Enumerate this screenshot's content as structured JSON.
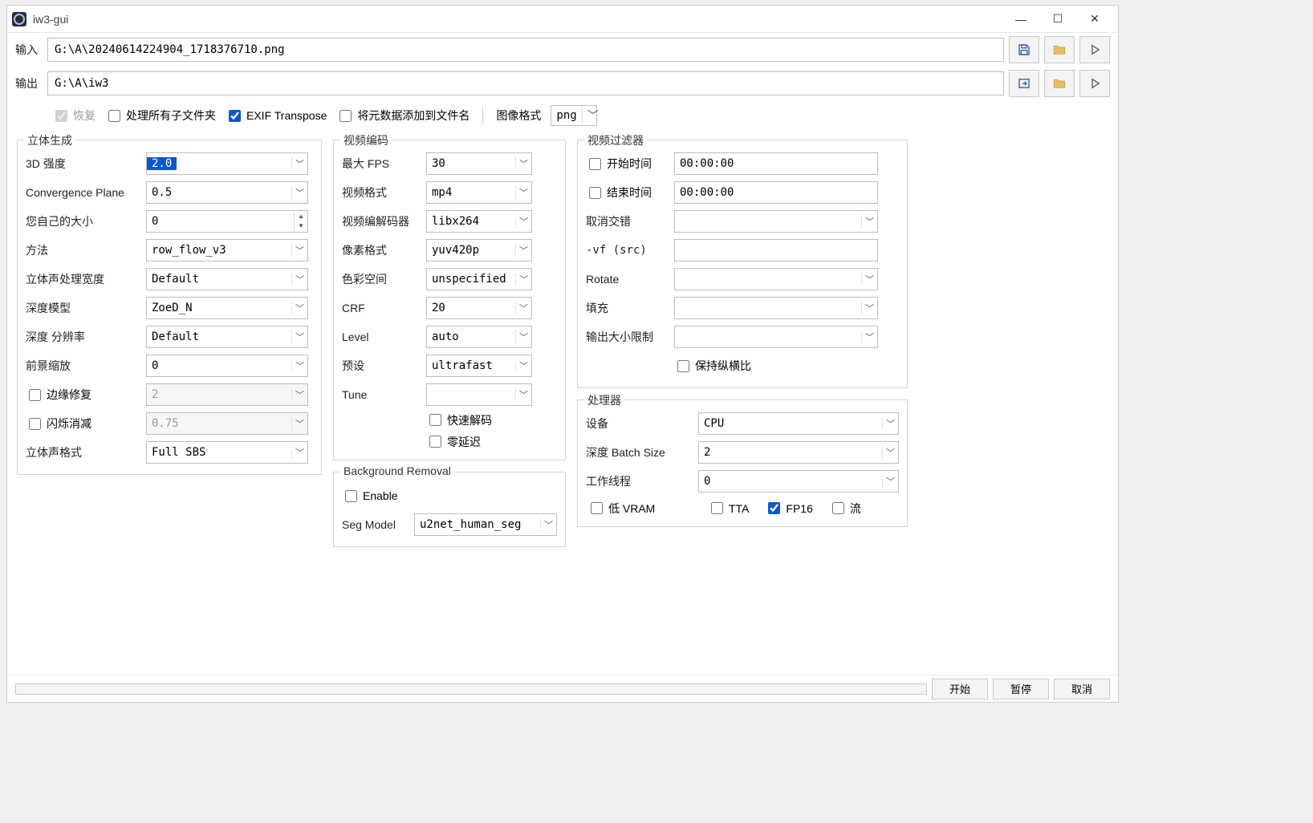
{
  "window_title": "iw3-gui",
  "io": {
    "input_label": "输入",
    "input_value": "G:\\A\\20240614224904_1718376710.png",
    "output_label": "输出",
    "output_value": "G:\\A\\iw3"
  },
  "options_row": {
    "restore": "恢复",
    "process_subfolders": "处理所有子文件夹",
    "exif_transpose": "EXIF Transpose",
    "append_metadata_to_filename": "将元数据添加到文件名",
    "image_format_label": "图像格式",
    "image_format_value": "png"
  },
  "stereo_gen": {
    "panel_title": "立体生成",
    "strength_label": "3D 强度",
    "strength_value": "2.0",
    "convergence_label": "Convergence Plane",
    "convergence_value": "0.5",
    "own_size_label": "您自己的大小",
    "own_size_value": "0",
    "method_label": "方法",
    "method_value": "row_flow_v3",
    "stereo_width_label": "立体声处理宽度",
    "stereo_width_value": "Default",
    "depth_model_label": "深度模型",
    "depth_model_value": "ZoeD_N",
    "depth_res_label": "深度 分辨率",
    "depth_res_value": "Default",
    "fg_zoom_label": "前景缩放",
    "fg_zoom_value": "0",
    "edge_repair_label": "边缘修复",
    "edge_repair_value": "2",
    "flicker_label": "闪烁消减",
    "flicker_value": "0.75",
    "stereo_format_label": "立体声格式",
    "stereo_format_value": "Full SBS"
  },
  "video_enc": {
    "panel_title": "视频编码",
    "max_fps_label": "最大 FPS",
    "max_fps_value": "30",
    "vformat_label": "视频格式",
    "vformat_value": "mp4",
    "vcodec_label": "视频编解码器",
    "vcodec_value": "libx264",
    "pix_fmt_label": "像素格式",
    "pix_fmt_value": "yuv420p",
    "colorspace_label": "色彩空间",
    "colorspace_value": "unspecified",
    "crf_label": "CRF",
    "crf_value": "20",
    "level_label": "Level",
    "level_value": "auto",
    "preset_label": "预设",
    "preset_value": "ultrafast",
    "tune_label": "Tune",
    "tune_value": "",
    "fast_decode": "快速解码",
    "zero_latency": "零延迟"
  },
  "video_filter": {
    "panel_title": "视频过滤器",
    "start_time_label": "开始时间",
    "start_time_value": "00:00:00",
    "end_time_label": "结束时间",
    "end_time_value": "00:00:00",
    "deinterlace_label": "取消交错",
    "deinterlace_value": "",
    "vf_src_label": "-vf (src)",
    "vf_src_value": "",
    "rotate_label": "Rotate",
    "rotate_value": "",
    "pad_label": "填充",
    "pad_value": "",
    "out_size_limit_label": "输出大小限制",
    "out_size_limit_value": "",
    "keep_aspect": "保持纵横比"
  },
  "bg_removal": {
    "panel_title": "Background Removal",
    "enable_label": "Enable",
    "seg_model_label": "Seg Model",
    "seg_model_value": "u2net_human_seg"
  },
  "processor": {
    "panel_title": "处理器",
    "device_label": "设备",
    "device_value": "CPU",
    "batch_size_label": "深度 Batch Size",
    "batch_size_value": "2",
    "worker_threads_label": "工作线程",
    "worker_threads_value": "0",
    "low_vram": "低 VRAM",
    "tta": "TTA",
    "fp16": "FP16",
    "stream": "流"
  },
  "bottom": {
    "start": "开始",
    "pause": "暂停",
    "cancel": "取消"
  }
}
